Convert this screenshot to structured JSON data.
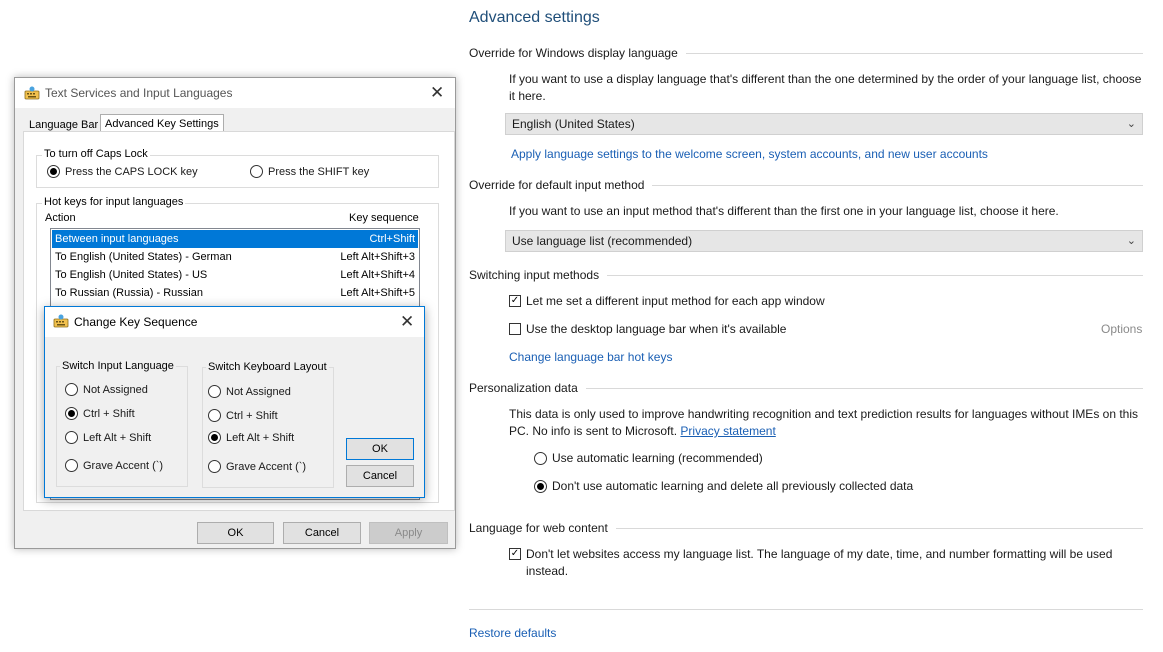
{
  "settings": {
    "title": "Advanced settings",
    "display_language": {
      "heading": "Override for Windows display language",
      "description": "If you want to use a display language that's different than the one determined by the order of your language list, choose it here.",
      "selected": "English (United States)",
      "apply_link": "Apply language settings to the welcome screen, system accounts, and new user accounts"
    },
    "input_method": {
      "heading": "Override for default input method",
      "description": "If you want to use an input method that's different than the first one in your language list, choose it here.",
      "selected": "Use language list (recommended)"
    },
    "switching": {
      "heading": "Switching input methods",
      "per_app_label": "Let me set a different input method for each app window",
      "per_app_checked": true,
      "desktop_bar_label": "Use the desktop language bar when it's available",
      "desktop_bar_checked": false,
      "options_label": "Options",
      "hotkeys_link": "Change language bar hot keys"
    },
    "personalization": {
      "heading": "Personalization data",
      "description": "This data is only used to improve handwriting recognition and text prediction results for languages without IMEs on this PC. No info is sent to Microsoft.",
      "privacy_link": "Privacy statement",
      "option_auto": "Use automatic learning (recommended)",
      "option_no_auto": "Don't use automatic learning and delete all previously collected data",
      "selected": "option_no_auto"
    },
    "web_content": {
      "heading": "Language for web content",
      "checkbox_label": "Don't let websites access my language list. The language of my date, time, and number formatting will be used instead.",
      "checked": true
    },
    "restore_link": "Restore defaults"
  },
  "text_services_dialog": {
    "title": "Text Services and Input Languages",
    "tabs": [
      "Language Bar",
      "Advanced Key Settings"
    ],
    "active_tab": 1,
    "caps_group": {
      "label": "To turn off Caps Lock",
      "option_caps": "Press the CAPS LOCK key",
      "option_shift": "Press the SHIFT key",
      "selected": "option_caps"
    },
    "hotkeys_group": {
      "label": "Hot keys for input languages",
      "col_action": "Action",
      "col_key": "Key sequence",
      "rows": [
        {
          "action": "Between input languages",
          "key": "Ctrl+Shift"
        },
        {
          "action": "To English (United States) - German",
          "key": "Left Alt+Shift+3"
        },
        {
          "action": "To English (United States) - US",
          "key": "Left Alt+Shift+4"
        },
        {
          "action": "To Russian (Russia) - Russian",
          "key": "Left Alt+Shift+5"
        }
      ],
      "selected_row": 0
    },
    "buttons": {
      "ok": "OK",
      "cancel": "Cancel",
      "apply": "Apply"
    }
  },
  "change_key_dialog": {
    "title": "Change Key Sequence",
    "input_language": {
      "label": "Switch Input Language",
      "options": [
        "Not Assigned",
        "Ctrl + Shift",
        "Left Alt + Shift",
        "Grave Accent (`)"
      ],
      "selected": 1
    },
    "keyboard_layout": {
      "label": "Switch Keyboard Layout",
      "options": [
        "Not Assigned",
        "Ctrl + Shift",
        "Left Alt + Shift",
        "Grave Accent (`)"
      ],
      "selected": 2
    },
    "buttons": {
      "ok": "OK",
      "cancel": "Cancel"
    }
  },
  "colors": {
    "accent": "#0078d7",
    "link": "#1a5fb4",
    "title": "#1f4e79"
  }
}
